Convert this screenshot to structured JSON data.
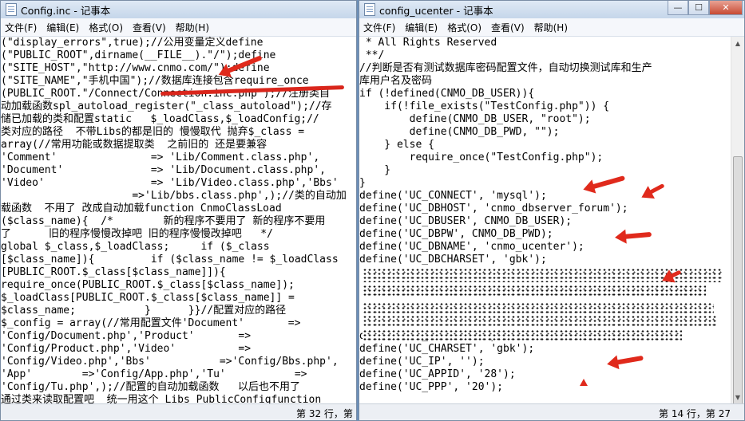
{
  "left_window": {
    "title": "Config.inc - 记事本",
    "menu": [
      "文件(F)",
      "编辑(E)",
      "格式(O)",
      "查看(V)",
      "帮助(H)"
    ],
    "lines": [
      "(\"display_errors\",true);//公用变量定义define",
      "(\"PUBLIC_ROOT\",dirname(__FILE__).\"/\");define",
      "(\"SITE_HOST\",\"http://www.cnmo.com/\");define",
      "(\"SITE_NAME\",\"手机中国\");//数据库连接包含require_once",
      "(PUBLIC_ROOT.\"/Connect/Connection.inc.php\");//注册类自",
      "动加载函数spl_autoload_register(\"_class_autoload\");//存",
      "储已加载的类和配置static   $_loadClass,$_loadConfig;//",
      "类对应的路径  不带Libs的都是旧的 慢慢取代 抛弃$_class =",
      "array(//常用功能或数据提取类  之前旧的 还是要兼容",
      "'Comment'               => 'Lib/Comment.class.php',",
      "'Document'              => 'Lib/Document.class.php',",
      "'Video'                 => 'Lib/Video.class.php','Bbs'",
      "                     =>'Lib/bbs.class.php',);//类的自动加",
      "载函数  不用了 改成自动加载function CnmoClassLoad",
      "($class_name){  /*        新的程序不要用了 新的程序不要用",
      "了      旧的程序慢慢改掉吧 旧的程序慢慢改掉吧   */",
      "global $_class,$_loadClass;     if ($_class",
      "[$class_name]){         if ($class_name != $_loadClass",
      "[PUBLIC_ROOT.$_class[$class_name]]){",
      "require_once(PUBLIC_ROOT.$_class[$class_name]);",
      "$_loadClass[PUBLIC_ROOT.$_class[$class_name]] =",
      "$class_name;           }      }}//配置对应的路径",
      "$_config = array(//常用配置文件'Document'       =>",
      "'Config/Document.php','Product'       =>",
      "'Config/Product.php','Video'          =>",
      "'Config/Video.php','Bbs'           =>'Config/Bbs.php',",
      "'App'        =>'Config/App.php','Tu'           =>",
      "'Config/Tu.php',);//配置的自动加载函数   以后也不用了",
      "通过类来读取配置吧  统一用这个 Libs_PublicConfigfunction"
    ],
    "status": "第 32 行，第"
  },
  "right_window": {
    "title": "config_ucenter - 记事本",
    "menu": [
      "文件(F)",
      "编辑(E)",
      "格式(O)",
      "查看(V)",
      "帮助(H)"
    ],
    "lines": [
      " * All Rights Reserved",
      " **/",
      "//判断是否有测试数据库密码配置文件，自动切换测试库和生产",
      "库用户名及密码",
      "if (!defined(CNMO_DB_USER)){",
      "    if(!file_exists(\"TestConfig.php\")) {",
      "        define(CNMO_DB_USER, \"root\");",
      "        define(CNMO_DB_PWD, \"\");",
      "    } else {",
      "        require_once(\"TestConfig.php\");",
      "    }",
      "}",
      "define('UC_CONNECT', 'mysql');",
      "define('UC_DBHOST', 'cnmo_dbserver_forum');",
      "define('UC_DBUSER', CNMO_DB_USER);",
      "define('UC_DBPW', CNMO_DB_PWD);",
      "define('UC_DBNAME', 'cnmo_ucenter');",
      "define('UC_DBCHARSET', 'gbk');",
      "",
      "",
      "",
      "",
      "",
      "define('UC_API', 'http://user.cnmo.com');",
      "define('UC_CHARSET', 'gbk');",
      "define('UC_IP', '');",
      "define('UC_APPID', '28');",
      "define('UC_PPP', '20');"
    ],
    "status": "第 14 行，第 27"
  },
  "colors": {
    "annotation_red": "#e02a1c",
    "titlebar": "#c5d6ea"
  }
}
